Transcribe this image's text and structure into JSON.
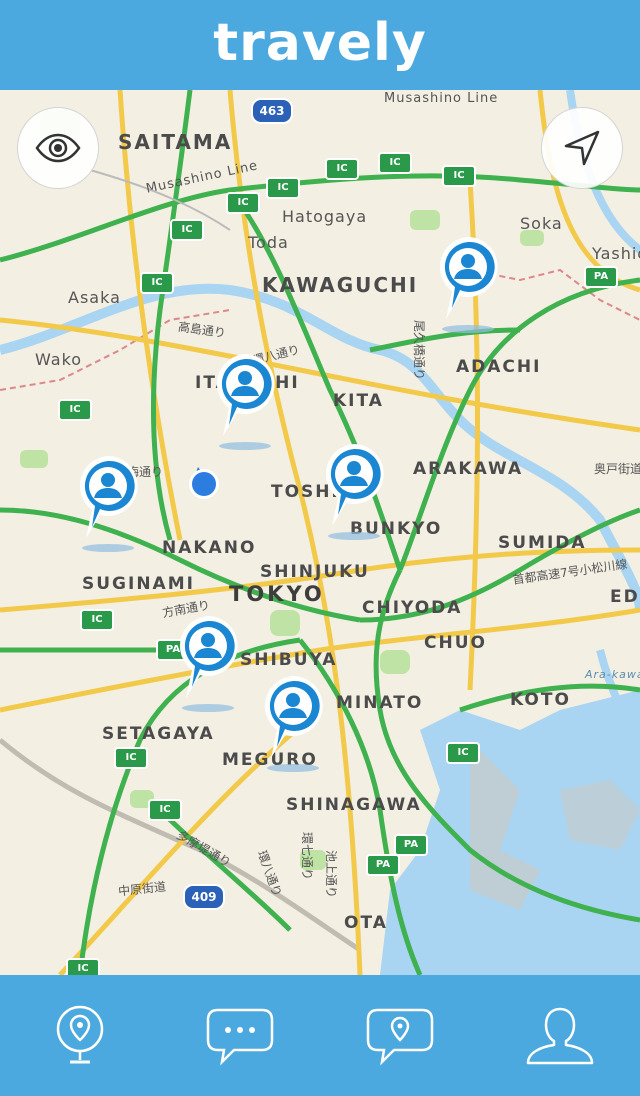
{
  "app": {
    "title": "travely"
  },
  "map": {
    "highway_badge": "IC",
    "pa_badge": "PA",
    "route_badges": [
      "463",
      "409"
    ],
    "districts": [
      "SAITAMA",
      "KAWAGUCHI",
      "ADACHI",
      "KITA",
      "ARAKAWA",
      "ITABASHI",
      "TOSHIMA",
      "BUNKYO",
      "SUMIDA",
      "NAKANO",
      "SHINJUKU",
      "SUGINAMI",
      "CHIYODA",
      "CHUO",
      "EDO",
      "SHIBUYA",
      "MINATO",
      "KOTO",
      "SETAGAYA",
      "MEGURO",
      "SHINAGAWA",
      "OTA"
    ],
    "city": "TOKYO",
    "small_labels": {
      "musashino_line_top": "Musashino Line",
      "musashino_line": "Musashino Line",
      "hatogaya": "Hatogaya",
      "toda": "Toda",
      "soka": "Soka",
      "yashio": "Yashio",
      "asaka": "Asaka",
      "wako": "Wako",
      "arakawa_river": "Ara-kawa River"
    },
    "jp_labels": [
      "高島通り",
      "環八通り",
      "尾久橋通り",
      "方南通り",
      "奥戸街道",
      "首都高速7号小松川線",
      "多摩堤通り",
      "中原街道",
      "環八通り",
      "環七通り",
      "池上通り",
      "青梅通り"
    ]
  },
  "controls": {
    "view_toggle_icon": "eye-icon",
    "locate_icon": "location-arrow-icon"
  },
  "pins": [
    {
      "icon": "user-pin-icon"
    },
    {
      "icon": "user-pin-icon"
    },
    {
      "icon": "user-pin-icon"
    },
    {
      "icon": "user-pin-icon"
    },
    {
      "icon": "user-pin-icon"
    },
    {
      "icon": "user-pin-icon"
    }
  ],
  "tabs": [
    {
      "name": "tab-map",
      "icon": "globe-pin-icon",
      "active": true
    },
    {
      "name": "tab-messages",
      "icon": "chat-bubble-icon"
    },
    {
      "name": "tab-checkins",
      "icon": "location-bubble-icon"
    },
    {
      "name": "tab-profile",
      "icon": "user-icon"
    }
  ],
  "colors": {
    "header": "#4ba9df",
    "pin": "#1b86d2",
    "road_green": "#3fb14f",
    "road_yellow": "#f3c94a",
    "water": "#a9d5f2"
  }
}
